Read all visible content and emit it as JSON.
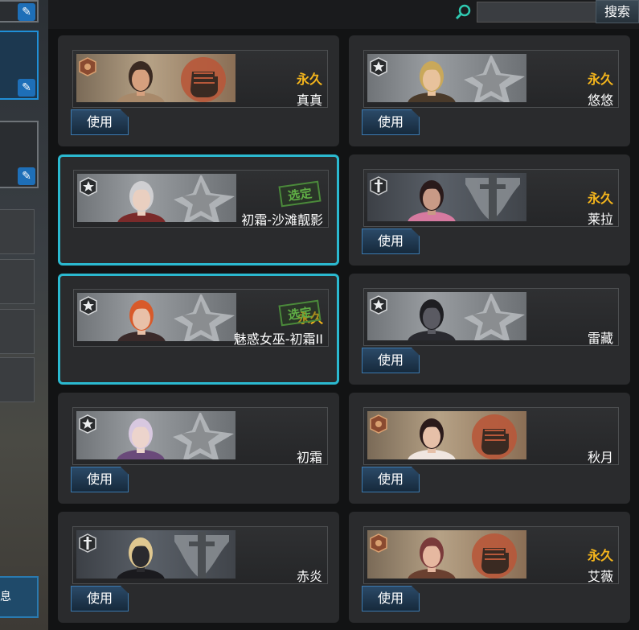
{
  "search": {
    "placeholder": "",
    "button_label": "搜索"
  },
  "left_strip": {
    "info_label": "息"
  },
  "use_label": "使用",
  "selected_label": "选定",
  "characters": [
    {
      "name": "真真",
      "status": "永久",
      "selected": false,
      "has_use": true,
      "banner": "bronze",
      "emblem": "fist-emblem",
      "rank": "bronze-rank-icon",
      "portrait_colors": [
        "#3a2a22",
        "#d6a07e",
        "#a8896a"
      ]
    },
    {
      "name": "悠悠",
      "status": "永久",
      "selected": false,
      "has_use": true,
      "banner": "silver",
      "emblem": "star-emblem",
      "rank": "star-rank-icon",
      "portrait_colors": [
        "#c9a85a",
        "#e8c29c",
        "#4a3a2a"
      ]
    },
    {
      "name": "初霜-沙滩靓影",
      "status": "",
      "selected": true,
      "has_use": false,
      "banner": "silver",
      "emblem": "star-emblem",
      "rank": "star-rank-icon",
      "portrait_colors": [
        "#cfcfd2",
        "#e9cfc0",
        "#7a2a2a"
      ]
    },
    {
      "name": "莱拉",
      "status": "永久",
      "selected": false,
      "has_use": true,
      "banner": "dark",
      "emblem": "sword-emblem",
      "rank": "sword-rank-icon",
      "portrait_colors": [
        "#2a1a1a",
        "#c89a86",
        "#d67aa0"
      ]
    },
    {
      "name": "魅惑女巫-初霜II",
      "status": "永久",
      "selected": true,
      "has_use": false,
      "banner": "silver",
      "emblem": "star-emblem",
      "rank": "star-rank-icon",
      "portrait_colors": [
        "#d85a2a",
        "#e8c0a8",
        "#3a2a2a"
      ]
    },
    {
      "name": "雷藏",
      "status": "",
      "selected": false,
      "has_use": true,
      "banner": "silver",
      "emblem": "star-emblem",
      "rank": "star-rank-icon",
      "portrait_colors": [
        "#1e1e22",
        "#5a5a62",
        "#2a2a30"
      ]
    },
    {
      "name": "初霜",
      "status": "",
      "selected": false,
      "has_use": true,
      "banner": "silver",
      "emblem": "star-emblem",
      "rank": "star-rank-icon",
      "portrait_colors": [
        "#d8c8e0",
        "#ecd4cc",
        "#6a4a7a"
      ]
    },
    {
      "name": "秋月",
      "status": "",
      "selected": false,
      "has_use": true,
      "banner": "bronze",
      "emblem": "fist-emblem",
      "rank": "bronze-rank-icon",
      "portrait_colors": [
        "#2a1a1a",
        "#e6c0a8",
        "#f0e6e0"
      ]
    },
    {
      "name": "赤炎",
      "status": "",
      "selected": false,
      "has_use": true,
      "banner": "dark",
      "emblem": "sword-emblem",
      "rank": "sword-rank-icon",
      "portrait_colors": [
        "#e0c890",
        "#2a2a2e",
        "#1a1a1e"
      ]
    },
    {
      "name": "艾薇",
      "status": "永久",
      "selected": false,
      "has_use": true,
      "banner": "bronze",
      "emblem": "fist-emblem",
      "rank": "bronze-rank-icon",
      "portrait_colors": [
        "#7a3a3a",
        "#e6b8a0",
        "#6a4030"
      ]
    }
  ]
}
